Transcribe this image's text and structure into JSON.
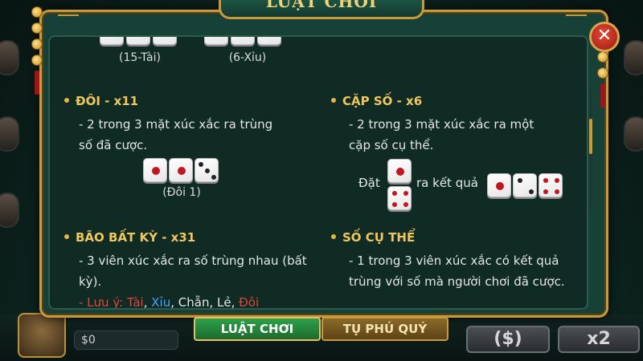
{
  "dialog": {
    "title": "LUẬT CHƠI",
    "close_label": "✕"
  },
  "top_labels": {
    "left": "(15-Tài)",
    "right": "(6-Xỉu)"
  },
  "sections": {
    "doi": {
      "heading": "ĐÔI - x11",
      "line1": "- 2 trong 3 mặt xúc xắc ra trùng",
      "line2": "số đã cược.",
      "caption": "(Đôi 1)"
    },
    "cap_so": {
      "heading": "CẶP SỐ - x6",
      "line1": "- 2 trong 3 mặt xúc xắc ra một",
      "line2": "cặp số cụ thể.",
      "bet_label": "Đặt",
      "result_label": "ra kết quả"
    },
    "bao": {
      "heading": "BÃO BẤT KỲ - x31",
      "line1": "- 3 viên xúc xắc ra số trùng nhau (bất",
      "line2": "kỳ).",
      "note_prefix": "- Lưu ý:",
      "note_tai": "Tài",
      "note_xiu": "Xỉu",
      "note_chan": "Chẵn",
      "note_le": "Lẻ",
      "note_doi": "Đôi"
    },
    "so_cu_the": {
      "heading": "SỐ CỤ THỂ",
      "line1": "- 1 trong 3 viên xúc xắc có kết quả",
      "line2": "trùng với số mà người chơi đã cược."
    }
  },
  "tabs": [
    {
      "label": "LUẬT CHƠI",
      "active": true
    },
    {
      "label": "TỤ PHÚ QUÝ",
      "active": false
    }
  ],
  "bottom_bar": {
    "money": "$0",
    "btn_currency": "($)",
    "btn_x2": "x2"
  },
  "colors": {
    "accent_gold": "#c79a3c",
    "heading": "#f0c660",
    "active_tab": "#2fa04a",
    "dialog_bg": "#0f2b24"
  }
}
